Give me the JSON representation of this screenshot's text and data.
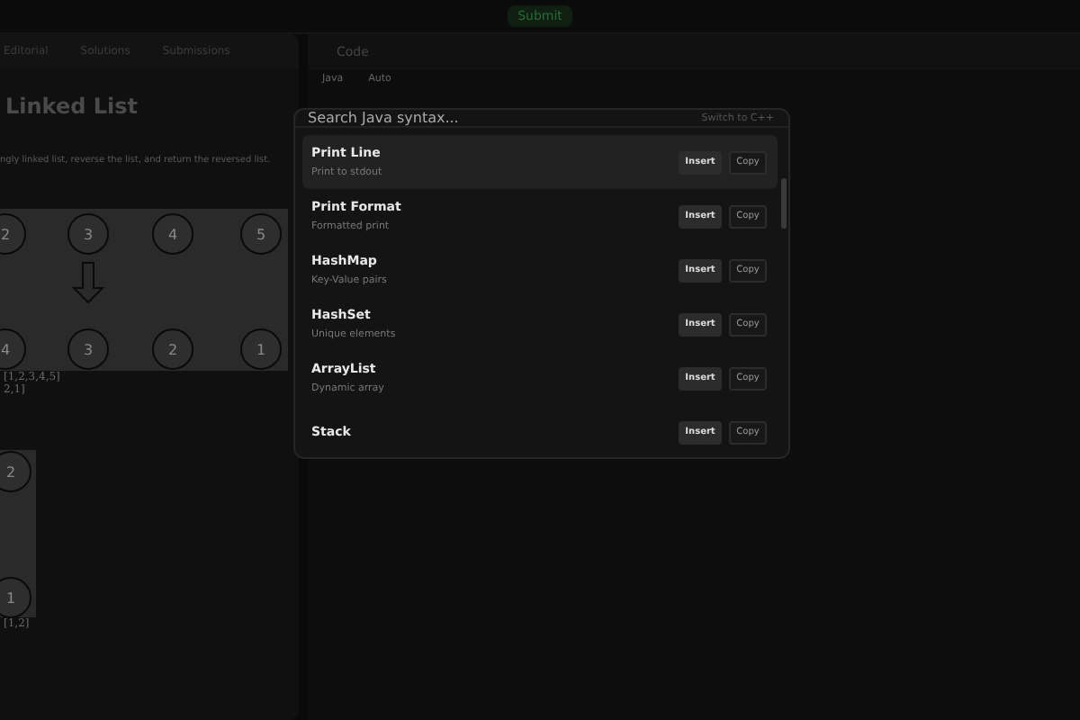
{
  "top_bar": {
    "submit": "Submit"
  },
  "problem": {
    "tabs": [
      {
        "label": "Editorial",
        "selected": false
      },
      {
        "label": "Solutions",
        "selected": false
      },
      {
        "label": "Submissions",
        "selected": false
      }
    ],
    "title": "Linked List",
    "description": "ngly linked list, reverse the list, and return the reversed list.",
    "diagram_1": {
      "top_nodes": [
        "2",
        "3",
        "4",
        "5"
      ],
      "bottom_nodes": [
        "4",
        "3",
        "2",
        "1"
      ]
    },
    "example_1": [
      "[1,2,3,4,5]",
      "2,1]"
    ],
    "diagram_2": {
      "nodes": [
        "2",
        "1"
      ]
    },
    "example_2": [
      "[1,2]"
    ]
  },
  "code_panel": {
    "tab": "Code",
    "language": "Java",
    "mode": "Auto"
  },
  "syntax_palette": {
    "search": {
      "placeholder": "Search Java syntax..."
    },
    "switch_link": "Switch to C++",
    "items": [
      {
        "name": "Print Line",
        "description": "Print to stdout",
        "selected": true,
        "insert": "Insert",
        "copy": "Copy"
      },
      {
        "name": "Print Format",
        "description": "Formatted print",
        "selected": false,
        "insert": "Insert",
        "copy": "Copy"
      },
      {
        "name": "HashMap",
        "description": "Key-Value pairs",
        "selected": false,
        "insert": "Insert",
        "copy": "Copy"
      },
      {
        "name": "HashSet",
        "description": "Unique elements",
        "selected": false,
        "insert": "Insert",
        "copy": "Copy"
      },
      {
        "name": "ArrayList",
        "description": "Dynamic array",
        "selected": false,
        "insert": "Insert",
        "copy": "Copy"
      },
      {
        "name": "Stack",
        "selected": false,
        "insert": "Insert",
        "copy": "Copy"
      }
    ]
  }
}
